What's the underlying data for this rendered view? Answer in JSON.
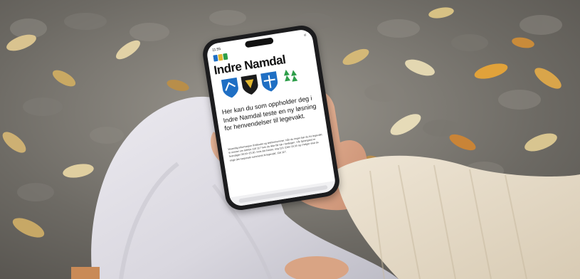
{
  "phone": {
    "status_time": "11:55",
    "status_menu": "≡",
    "site_title": "Indre Namdal",
    "heading": "Her kan du som oppholder deg i Indre Namdal teste en ny løsning for henvendelser til legevakt.",
    "body_text": "Vesentlig informasjon til tilbudet og telefonnummer. Når du ringer bør du ha legevakt. Vi minner om telefon 116 117 hvis du ikke får tak i fastlegen. Vår åpningstid er hverdager 08:00–15:30. Hvis det haster, ring 113. Etter 15:30 og i helger skal du ringe det nasjonale nummeret til legevakt: 116 117.",
    "crests": [
      "blue-crest",
      "black-gold-crest",
      "blue-cross-crest"
    ],
    "trees": "green-tree-icons"
  },
  "colors": {
    "crest_blue": "#1f6fc4",
    "crest_gold": "#e1b62d",
    "tree_green": "#2e9e4a"
  }
}
